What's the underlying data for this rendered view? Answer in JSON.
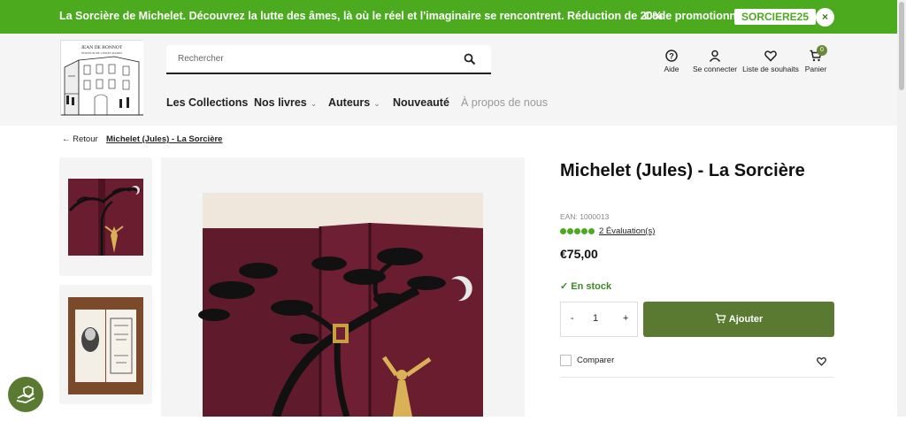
{
  "promo": {
    "text": "La Sorcière de Michelet. Découvrez la lutte des âmes, là où le réel et l'imaginaire se rencontrent. Réduction de 20%",
    "code_label": "Code promotionnel",
    "code": "SORCIERE25",
    "close": "×"
  },
  "header": {
    "search_placeholder": "Rechercher",
    "logo_text": [
      "JEAN DE BONNOT",
      "ÉDITEUR DE LIVRES RARES"
    ],
    "nav": [
      {
        "label": "Les Collections"
      },
      {
        "label": "Nos livres",
        "chevron": "⌄"
      },
      {
        "label": "Auteurs",
        "chevron": "⌄"
      },
      {
        "label": "Nouveauté"
      },
      {
        "label": "À propos de nous"
      }
    ],
    "icons": {
      "help": "Aide",
      "login": "Se connecter",
      "wishlist": "Liste de souhaits",
      "cart": "Panier",
      "cart_count": "0"
    }
  },
  "breadcrumb": {
    "back": "Retour",
    "current": "Michelet (Jules) - La Sorcière"
  },
  "product": {
    "title": "Michelet (Jules) - La Sorcière",
    "ean": "EAN: 1000013",
    "rating": 5,
    "reviews": "2 Évaluation(s)",
    "price": "€75,00",
    "stock": "En stock",
    "qty_minus": "-",
    "qty": "1",
    "qty_plus": "+",
    "add_label": "Ajouter",
    "compare": "Comparer"
  },
  "colors": {
    "promo_green": "#4caa1f",
    "button_green": "#5a7a32",
    "book_maroon": "#6e1f33"
  }
}
